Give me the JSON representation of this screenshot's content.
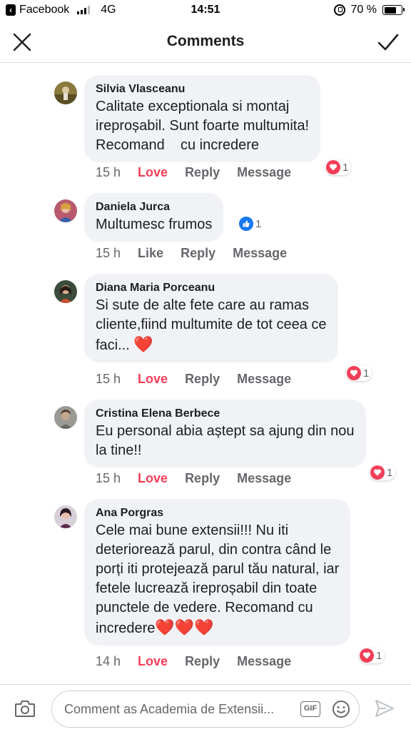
{
  "status_bar": {
    "app": "Facebook",
    "network": "4G",
    "time": "14:51",
    "battery": "70 %"
  },
  "header": {
    "title": "Comments"
  },
  "icons": {
    "close": "close-icon",
    "confirm": "checkmark-icon",
    "camera": "camera-icon",
    "gif": "GIF",
    "emoji": "emoji-icon",
    "send": "send-icon"
  },
  "comments": [
    {
      "author": "Silvia Vlasceanu",
      "text": "Calitate exceptionala si montaj\nireproșabil. Sunt foarte multumita!\nRecomand    cu incredere",
      "time": "15 h",
      "react_label": "Love",
      "reply": "Reply",
      "message": "Message",
      "reaction_type": "love",
      "reaction_count": "1"
    },
    {
      "author": "Daniela Jurca",
      "text": "Multumesc frumos",
      "time": "15 h",
      "react_label": "Like",
      "reply": "Reply",
      "message": "Message",
      "reaction_type": "like",
      "reaction_count": "1"
    },
    {
      "author": "Diana Maria Porceanu",
      "text": "Si sute de alte fete care au ramas\ncliente,fiind multumite de tot ceea ce\nfaci... ",
      "text_emoji": "❤️",
      "time": "15 h",
      "react_label": "Love",
      "reply": "Reply",
      "message": "Message",
      "reaction_type": "love",
      "reaction_count": "1"
    },
    {
      "author": "Cristina Elena Berbece",
      "text": "Eu personal abia aștept sa ajung din nou\nla tine!!",
      "time": "15 h",
      "react_label": "Love",
      "reply": "Reply",
      "message": "Message",
      "reaction_type": "love",
      "reaction_count": "1"
    },
    {
      "author": "Ana Porgras",
      "text": "Cele mai bune extensii!!! Nu iti\ndeteriorează parul, din contra când le\nporți iti protejează parul tău natural, iar\nfetele lucrează ireproșabil din toate\npunctele de vedere. Recomand cu\nincredere",
      "text_emoji": "❤️❤️❤️",
      "time": "14 h",
      "react_label": "Love",
      "reply": "Reply",
      "message": "Message",
      "reaction_type": "love",
      "reaction_count": "1"
    }
  ],
  "composer": {
    "placeholder": "Comment as Academia de Extensii..."
  },
  "colors": {
    "love": "#f33e58",
    "like": "#1877f2",
    "bubble": "#f0f2f5",
    "secondary_text": "#65676b"
  }
}
